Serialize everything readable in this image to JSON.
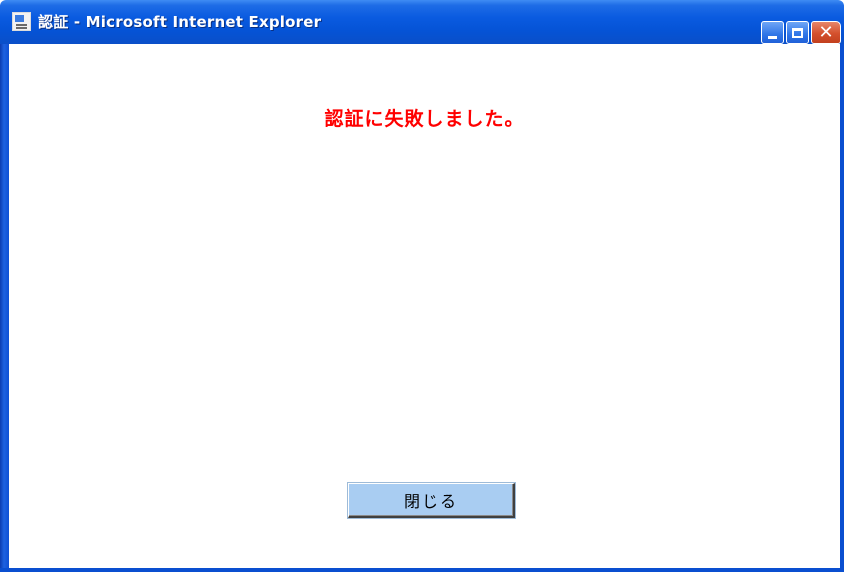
{
  "window": {
    "title": "認証 - Microsoft Internet Explorer",
    "icon": "ie-page-icon",
    "controls": {
      "minimize": "minimize-icon",
      "maximize": "maximize-icon",
      "close": "close-icon",
      "close_glyph": "✕"
    }
  },
  "main": {
    "message": "認証に失敗しました。",
    "message_color": "#ff0000",
    "close_button_label": "閉じる"
  }
}
